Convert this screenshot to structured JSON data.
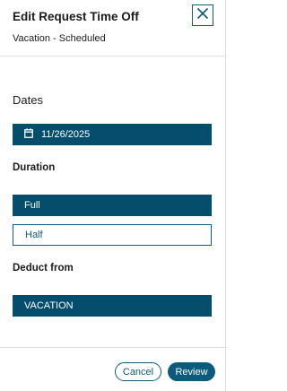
{
  "header": {
    "title": "Edit Request Time Off",
    "subtitle": "Vacation - Scheduled",
    "close_icon": "close-icon"
  },
  "dates": {
    "label": "Dates",
    "value": "11/26/2025",
    "icon": "calendar-icon"
  },
  "duration": {
    "label": "Duration",
    "options": [
      {
        "label": "Full",
        "selected": true
      },
      {
        "label": "Half",
        "selected": false
      }
    ]
  },
  "deduct": {
    "label": "Deduct from",
    "value": "VACATION"
  },
  "footer": {
    "cancel_label": "Cancel",
    "review_label": "Review"
  },
  "colors": {
    "accent": "#054d6d",
    "accent_border": "#0b5b7c",
    "divider": "#dadde1"
  }
}
